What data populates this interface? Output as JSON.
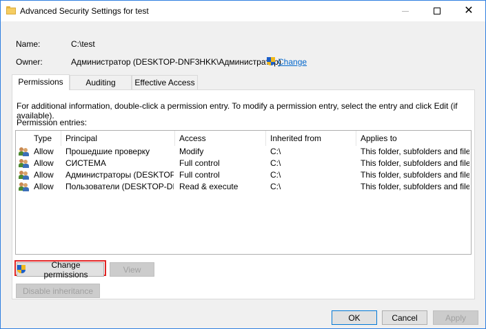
{
  "window": {
    "title": "Advanced Security Settings for test",
    "close_glyph": "✕"
  },
  "info": {
    "name_label": "Name:",
    "name_value": "C:\\test",
    "owner_label": "Owner:",
    "owner_value": "Администратор (DESKTOP-DNF3HKK\\Администратор)",
    "change_link": "Change"
  },
  "tabs": [
    {
      "label": "Permissions",
      "active": true
    },
    {
      "label": "Auditing",
      "active": false
    },
    {
      "label": "Effective Access",
      "active": false
    }
  ],
  "instructions": "For additional information, double-click a permission entry. To modify a permission entry, select the entry and click Edit (if available).",
  "entries_label": "Permission entries:",
  "columns": {
    "type": "Type",
    "principal": "Principal",
    "access": "Access",
    "inherited_from": "Inherited from",
    "applies_to": "Applies to"
  },
  "entries": [
    {
      "type": "Allow",
      "principal": "Прошедшие проверку",
      "access": "Modify",
      "inherited_from": "C:\\",
      "applies_to": "This folder, subfolders and files"
    },
    {
      "type": "Allow",
      "principal": "СИСТЕМА",
      "access": "Full control",
      "inherited_from": "C:\\",
      "applies_to": "This folder, subfolders and files"
    },
    {
      "type": "Allow",
      "principal": "Администраторы (DESKTOP-...",
      "access": "Full control",
      "inherited_from": "C:\\",
      "applies_to": "This folder, subfolders and files"
    },
    {
      "type": "Allow",
      "principal": "Пользователи (DESKTOP-DN...",
      "access": "Read & execute",
      "inherited_from": "C:\\",
      "applies_to": "This folder, subfolders and files"
    }
  ],
  "buttons": {
    "change_permissions": "Change permissions",
    "view": "View",
    "disable_inheritance": "Disable inheritance",
    "ok": "OK",
    "cancel": "Cancel",
    "apply": "Apply"
  },
  "colors": {
    "link": "#0066cc",
    "highlight": "#e02424",
    "focus": "#0078d7"
  }
}
